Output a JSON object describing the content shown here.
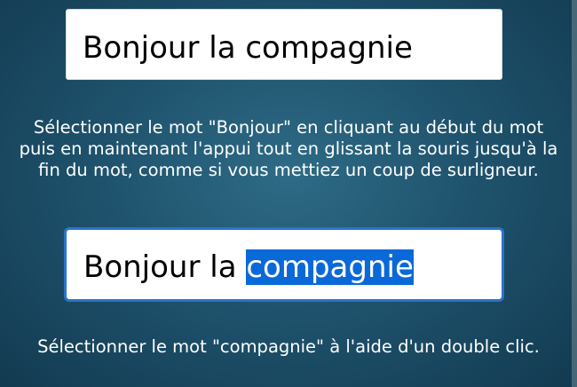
{
  "field_1": {
    "value": "Bonjour la compagnie"
  },
  "instruction_1": "Sélectionner le mot \"Bonjour\" en cliquant au début du mot puis en maintenant l'appui tout en glissant la souris jusqu'à la fin du mot, comme si vous mettiez un coup de surligneur.",
  "field_2": {
    "text_before_selection": "Bonjour la ",
    "selected_text": "compagnie"
  },
  "instruction_2": "Sélectionner le mot \"compagnie\" à l'aide d'un double clic.",
  "colors": {
    "focus_border": "#2a73c9",
    "selection_highlight": "#0a69d9"
  }
}
